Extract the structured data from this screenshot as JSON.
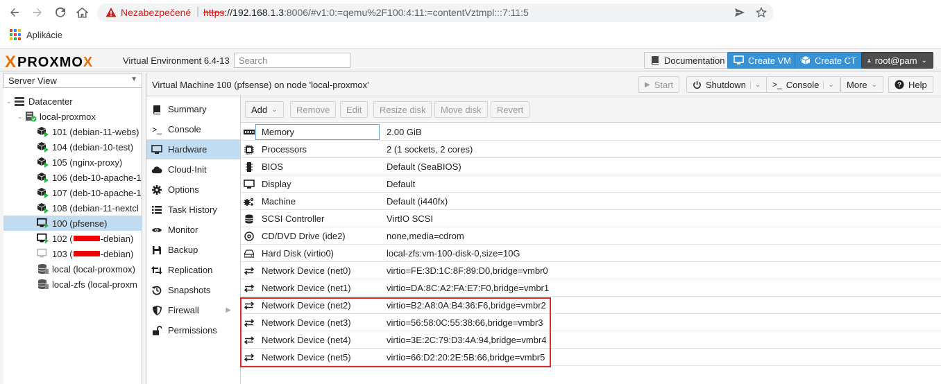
{
  "browser": {
    "insecure_label": "Nezabezpečené",
    "url_scheme": "https",
    "url_host": "://192.168.1.3",
    "url_rest": ":8006/#v1:0:=qemu%2F100:4:11:=contentVztmpl:::7:11:5",
    "bookmark_apps": "Aplikácie"
  },
  "header": {
    "logo_x": "X",
    "logo_word": "PROXMO",
    "logo_x2": "X",
    "version": "Virtual Environment 6.4-13",
    "search_placeholder": "Search",
    "documentation": "Documentation",
    "create_vm": "Create VM",
    "create_ct": "Create CT",
    "user": "root@pam"
  },
  "left": {
    "view": "Server View",
    "tree": [
      {
        "label": "Datacenter",
        "icon": "datacenter-icon"
      },
      {
        "label": "local-proxmox",
        "icon": "node-icon"
      },
      {
        "label": "101 (debian-11-webs)",
        "icon": "ct-running-icon"
      },
      {
        "label": "104 (debian-10-test)",
        "icon": "ct-running-icon"
      },
      {
        "label": "105 (nginx-proxy)",
        "icon": "ct-running-icon"
      },
      {
        "label": "106 (deb-10-apache-1",
        "icon": "ct-running-icon"
      },
      {
        "label": "107 (deb-10-apache-1",
        "icon": "ct-running-icon"
      },
      {
        "label": "108 (debian-11-nextcl",
        "icon": "ct-running-icon"
      },
      {
        "label": "100 (pfsense)",
        "icon": "vm-running-icon"
      },
      {
        "label_pre": "102 (",
        "label_post": "-debian)",
        "icon": "vm-running-icon"
      },
      {
        "label_pre": "103 (",
        "label_post": "-debian)",
        "icon": "vm-stopped-icon"
      },
      {
        "label": "local (local-proxmox)",
        "icon": "storage-icon"
      },
      {
        "label": "local-zfs (local-proxm",
        "icon": "storage-icon"
      }
    ]
  },
  "main": {
    "title": "Virtual Machine 100 (pfsense) on node 'local-proxmox'",
    "start": "Start",
    "shutdown": "Shutdown",
    "console": "Console",
    "more": "More",
    "help": "Help"
  },
  "subnav": [
    {
      "label": "Summary",
      "icon": "book-icon"
    },
    {
      "label": "Console",
      "icon": "terminal-icon"
    },
    {
      "label": "Hardware",
      "icon": "desktop-icon"
    },
    {
      "label": "Cloud-Init",
      "icon": "cloud-icon"
    },
    {
      "label": "Options",
      "icon": "gear-icon"
    },
    {
      "label": "Task History",
      "icon": "list-icon"
    },
    {
      "label": "Monitor",
      "icon": "eye-icon"
    },
    {
      "label": "Backup",
      "icon": "floppy-icon"
    },
    {
      "label": "Replication",
      "icon": "retweet-icon"
    },
    {
      "label": "Snapshots",
      "icon": "history-icon"
    },
    {
      "label": "Firewall",
      "icon": "shield-icon"
    },
    {
      "label": "Permissions",
      "icon": "unlock-icon"
    }
  ],
  "hw_toolbar": {
    "add": "Add",
    "remove": "Remove",
    "edit": "Edit",
    "resize": "Resize disk",
    "move": "Move disk",
    "revert": "Revert"
  },
  "hardware": [
    {
      "name": "Memory",
      "value": "2.00 GiB",
      "icon": "memory-icon"
    },
    {
      "name": "Processors",
      "value": "2 (1 sockets, 2 cores)",
      "icon": "cpu-icon"
    },
    {
      "name": "BIOS",
      "value": "Default (SeaBIOS)",
      "icon": "microchip-icon"
    },
    {
      "name": "Display",
      "value": "Default",
      "icon": "desktop-icon"
    },
    {
      "name": "Machine",
      "value": "Default (i440fx)",
      "icon": "cogs-icon"
    },
    {
      "name": "SCSI Controller",
      "value": "VirtIO SCSI",
      "icon": "database-icon"
    },
    {
      "name": "CD/DVD Drive (ide2)",
      "value": "none,media=cdrom",
      "icon": "cdrom-icon"
    },
    {
      "name": "Hard Disk (virtio0)",
      "value": "local-zfs:vm-100-disk-0,size=10G",
      "icon": "hdd-icon"
    },
    {
      "name": "Network Device (net0)",
      "value": "virtio=FE:3D:1C:8F:89:D0,bridge=vmbr0",
      "icon": "exchange-icon"
    },
    {
      "name": "Network Device (net1)",
      "value": "virtio=DA:8C:A2:FA:E7:F0,bridge=vmbr1",
      "icon": "exchange-icon"
    },
    {
      "name": "Network Device (net2)",
      "value": "virtio=B2:A8:0A:B4:36:F6,bridge=vmbr2",
      "icon": "exchange-icon"
    },
    {
      "name": "Network Device (net3)",
      "value": "virtio=56:58:0C:55:38:66,bridge=vmbr3",
      "icon": "exchange-icon"
    },
    {
      "name": "Network Device (net4)",
      "value": "virtio=3E:2C:79:D3:4A:94,bridge=vmbr4",
      "icon": "exchange-icon"
    },
    {
      "name": "Network Device (net5)",
      "value": "virtio=66:D2:20:2E:5B:66,bridge=vmbr5",
      "icon": "exchange-icon"
    }
  ],
  "colors": {
    "accent_orange": "#e57000",
    "selected_row": "#c2ddf2",
    "button_blue": "#3892d4",
    "highlight_red": "#d82a2a",
    "running_green": "#2db14a"
  }
}
